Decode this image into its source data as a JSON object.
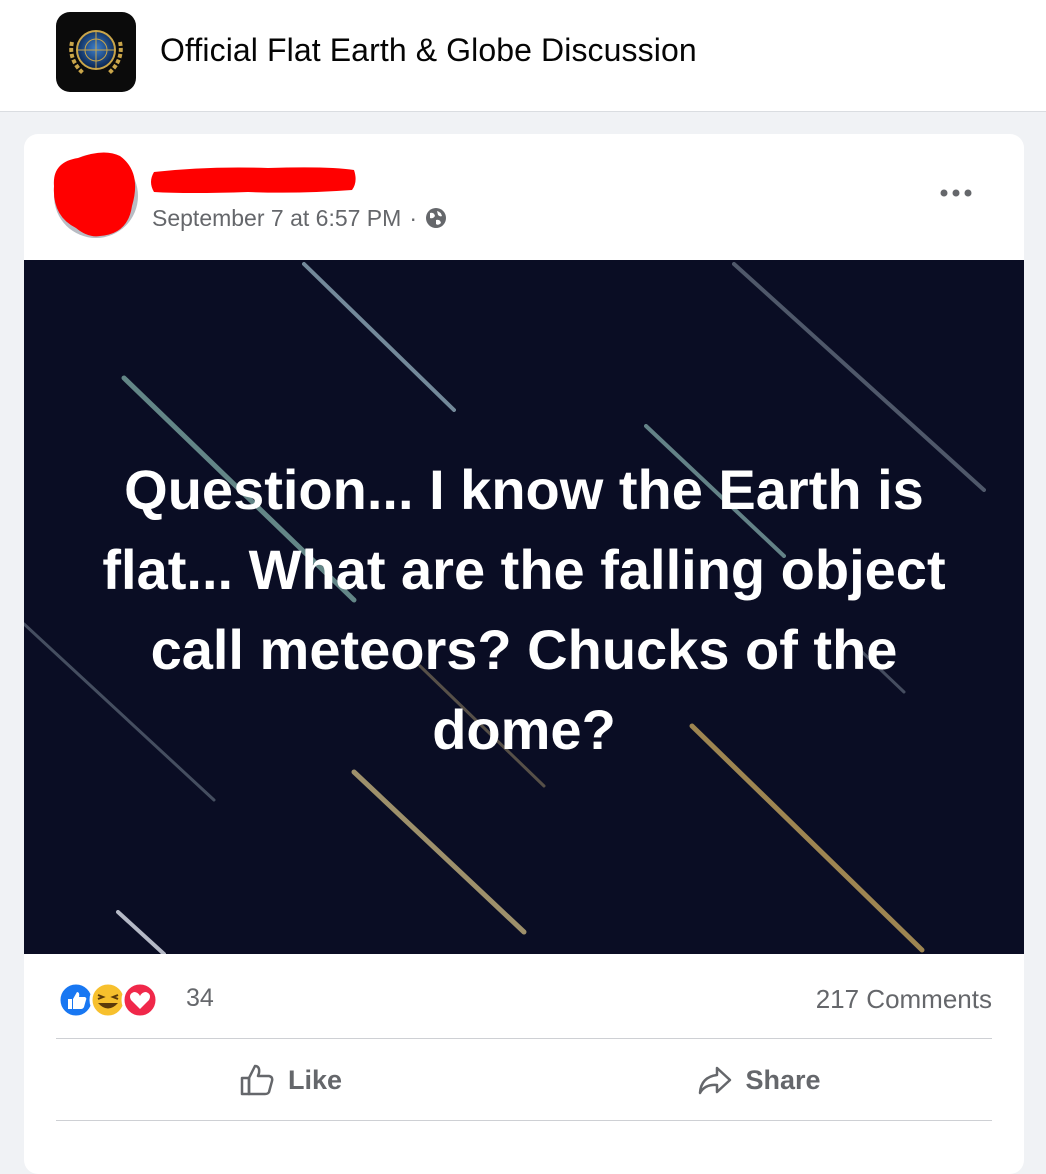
{
  "group": {
    "name": "Official Flat Earth & Globe Discussion",
    "logo_icon": "un-emblem-logo"
  },
  "post": {
    "timestamp": "September 7 at 6:57 PM",
    "separator": "·",
    "privacy_icon": "globe-icon",
    "more_icon": "more-options-icon",
    "image_text": "Question... I know the Earth is flat... What are the falling object call meteors? Chucks of the dome?",
    "image_background": "#0a0d24",
    "redaction_color": "#ff0000"
  },
  "stats": {
    "reaction_icons": [
      "like-reaction-icon",
      "haha-reaction-icon",
      "love-reaction-icon"
    ],
    "reaction_count": "34",
    "comments": "217 Comments"
  },
  "actions": {
    "like_label": "Like",
    "share_label": "Share"
  }
}
